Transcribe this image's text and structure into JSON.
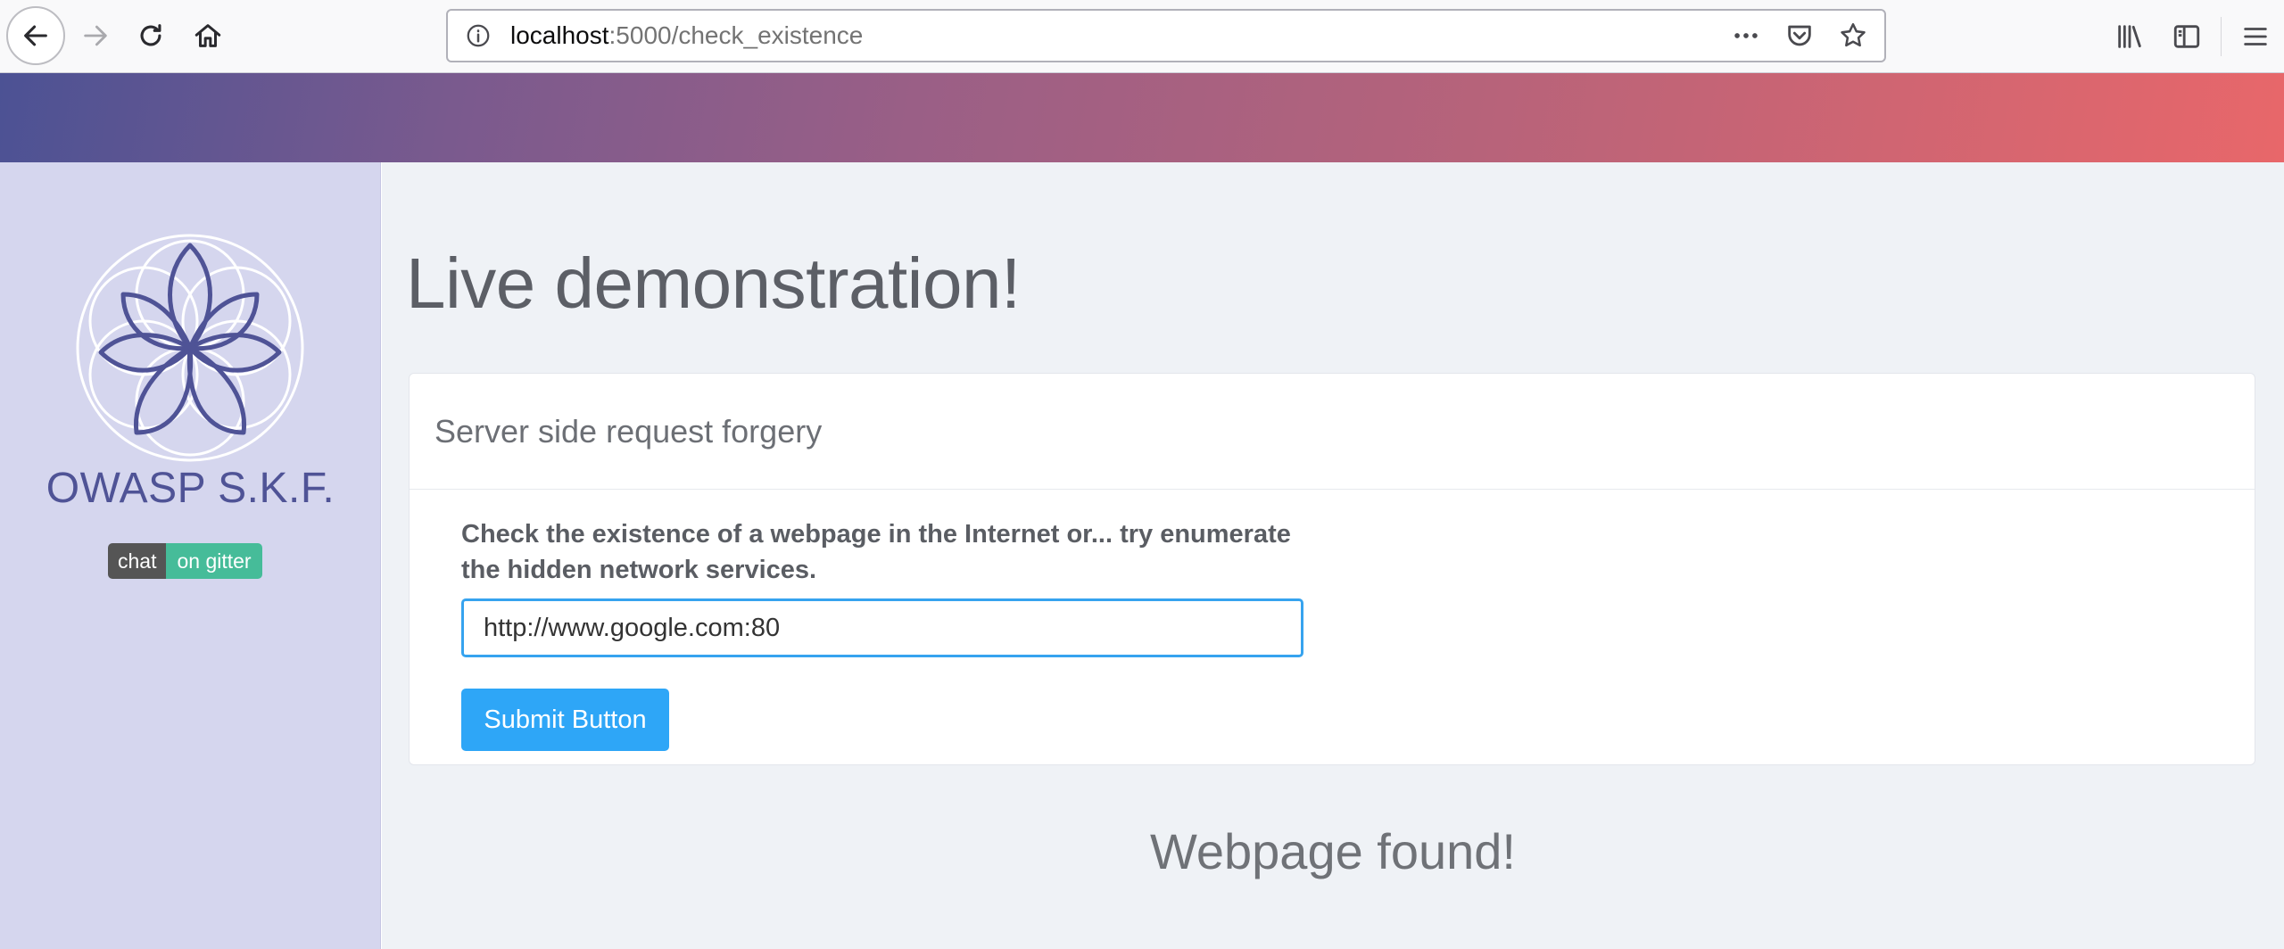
{
  "browser": {
    "url_host": "localhost",
    "url_path": ":5000/check_existence",
    "icons": {
      "back": "back-arrow-icon",
      "forward": "forward-arrow-icon",
      "reload": "reload-icon",
      "home": "home-icon",
      "info": "info-icon",
      "more": "more-actions-icon",
      "pocket": "pocket-icon",
      "bookmark": "star-icon",
      "library": "library-icon",
      "sidebar": "sidebar-icon",
      "menu": "hamburger-menu-icon"
    }
  },
  "header": {
    "gradient_start": "#4c5294",
    "gradient_end": "#e8676a"
  },
  "sidebar": {
    "logo_title": "OWASP S.K.F.",
    "badge_left": "chat",
    "badge_right": "on gitter",
    "background": "#d5d6ee",
    "logo_color": "#4f5396"
  },
  "main": {
    "title": "Live demonstration!",
    "card": {
      "header": "Server side request forgery",
      "label": "Check the existence of a webpage in the Internet or... try enumerate the hidden network services.",
      "input_value": "http://www.google.com:80",
      "submit_label": "Submit Button"
    },
    "result": "Webpage found!",
    "accent": "#2ea6f7"
  }
}
